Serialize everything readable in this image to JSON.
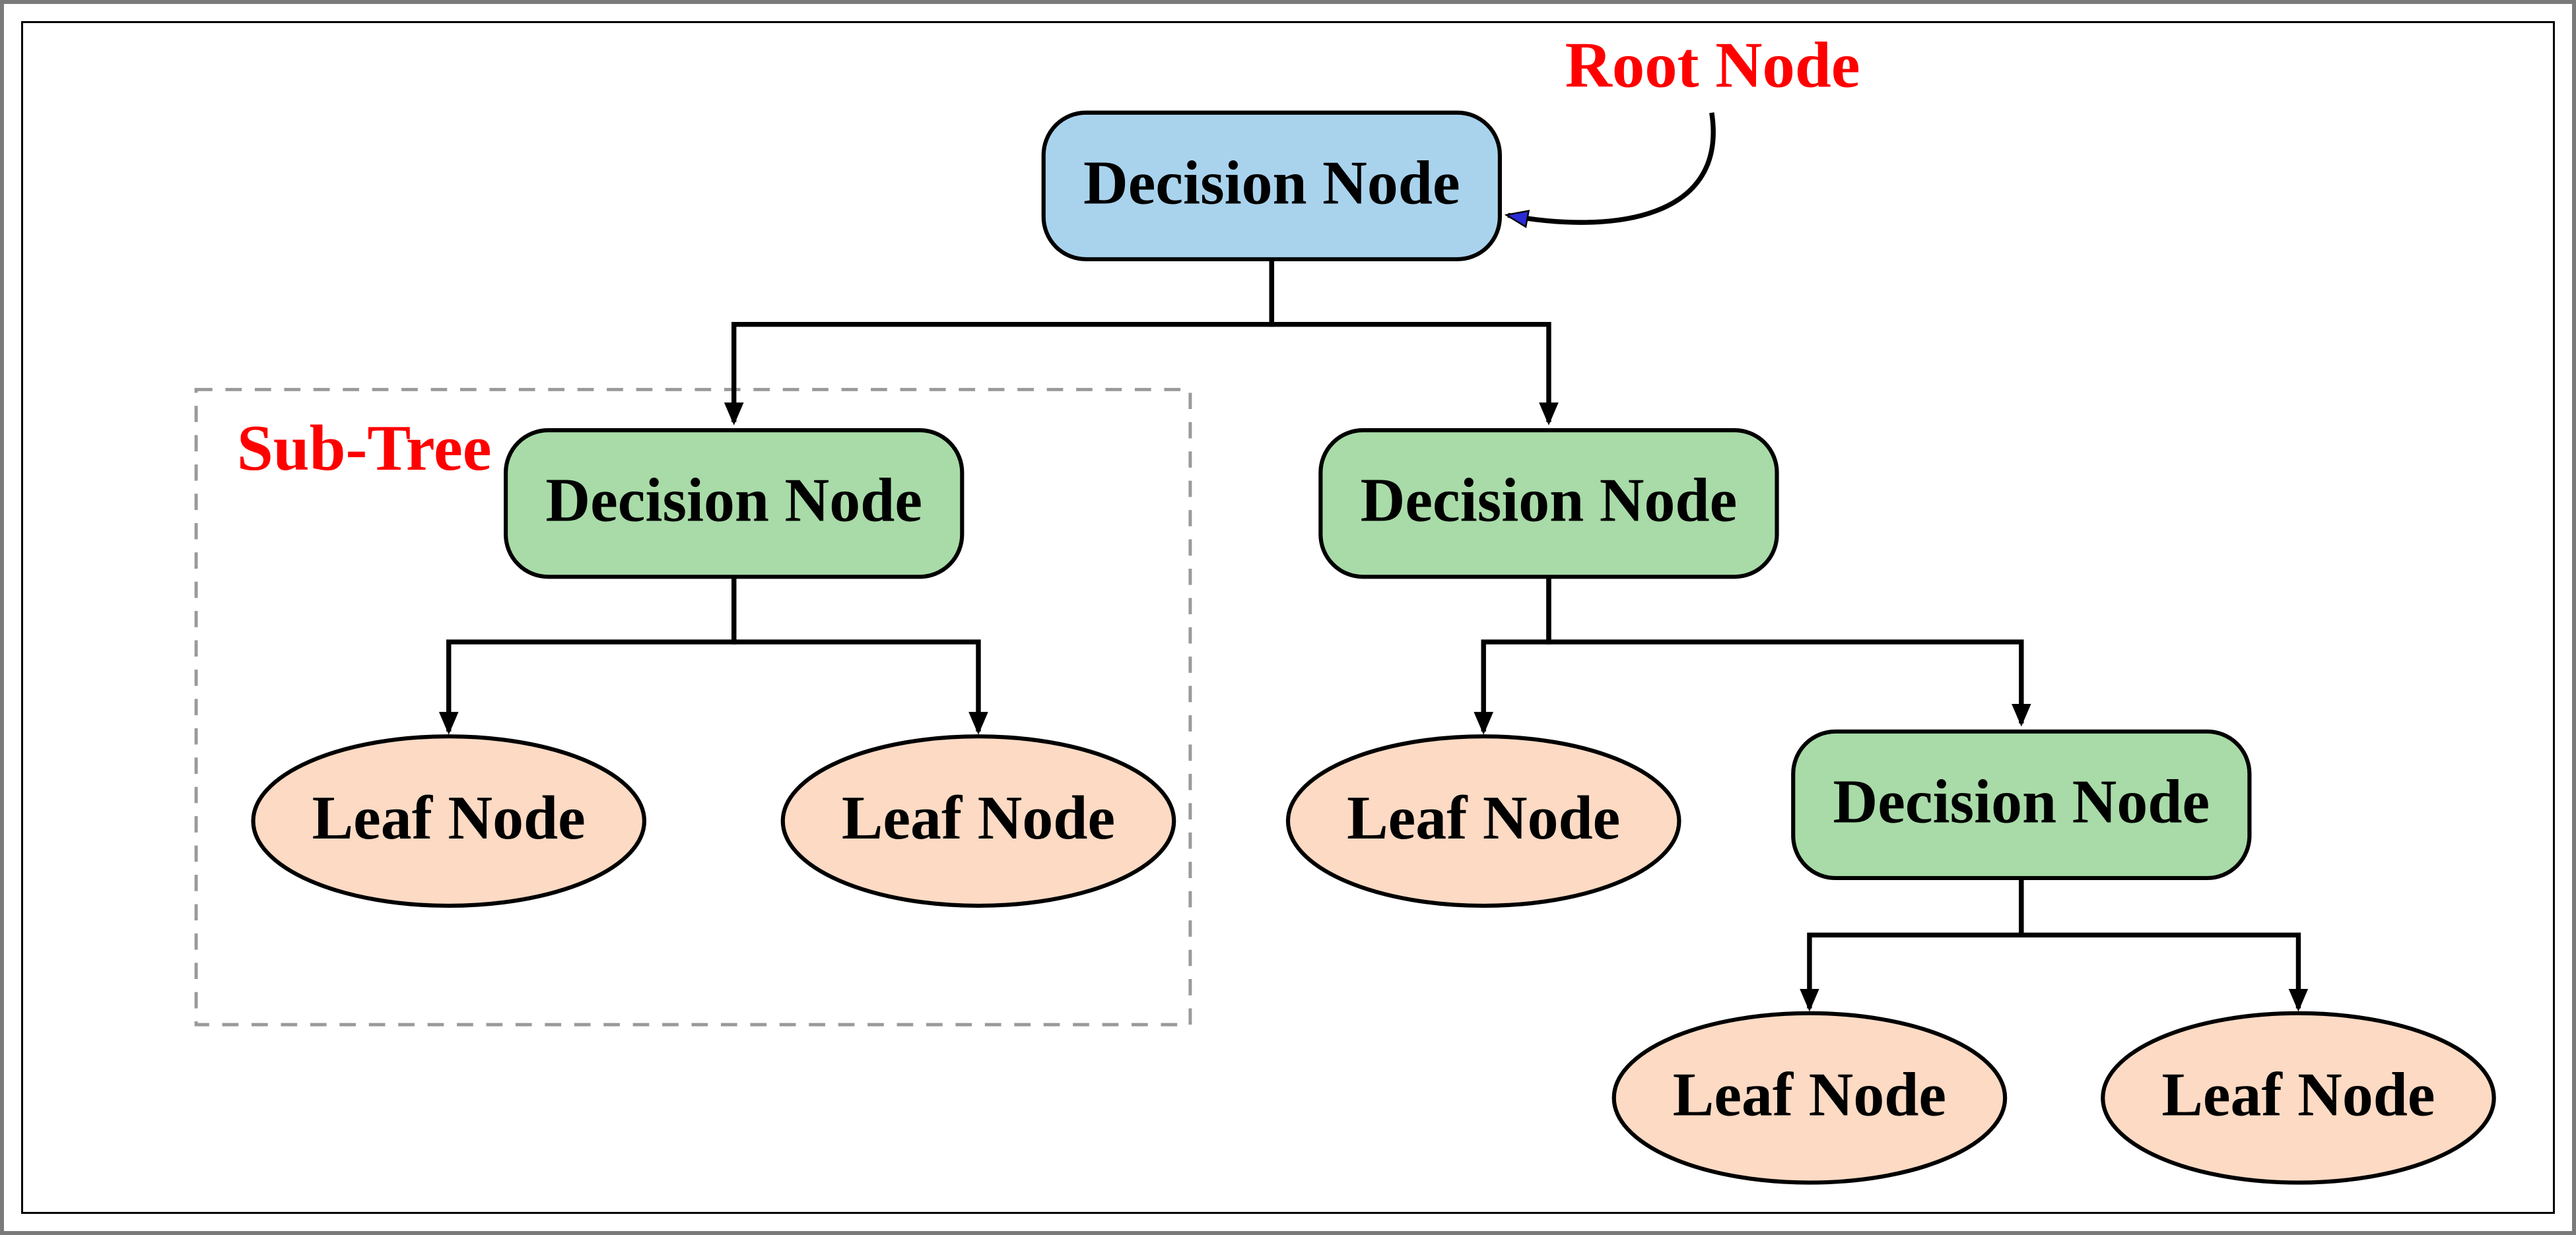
{
  "annotations": {
    "root_label": "Root Node",
    "subtree_label": "Sub-Tree"
  },
  "nodes": {
    "root": "Decision Node",
    "left_decision": "Decision Node",
    "right_decision": "Decision Node",
    "leaf_ll": "Leaf Node",
    "leaf_lr": "Leaf Node",
    "leaf_rl": "Leaf Node",
    "right_right_decision": "Decision Node",
    "leaf_rrl": "Leaf Node",
    "leaf_rrr": "Leaf Node"
  },
  "colors": {
    "root_fill": "#a9d3ed",
    "decision_fill": "#a8dba8",
    "leaf_fill": "#fcdac4",
    "annotation": "#ff0000",
    "border": "#000000",
    "outer_border": "#7a7a7a"
  }
}
